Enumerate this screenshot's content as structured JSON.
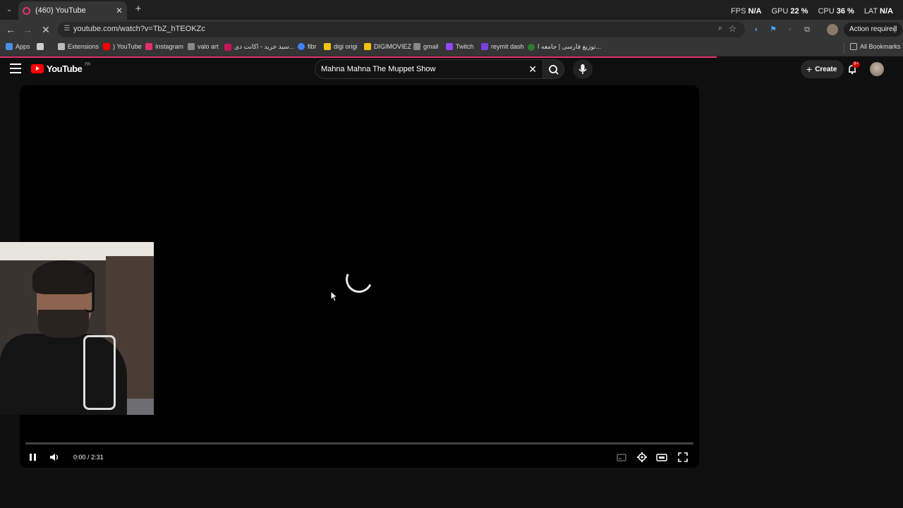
{
  "browser": {
    "tab_title": "(460) YouTube",
    "perf": {
      "fps_label": "FPS",
      "fps_value": "N/A",
      "gpu_label": "GPU",
      "gpu_value": "22 %",
      "cpu_label": "CPU",
      "cpu_value": "36 %",
      "lat_label": "LAT",
      "lat_value": "N/A"
    },
    "url": "youtube.com/watch?v=TbZ_hTEOKZc",
    "action_required": "Action required",
    "accent": "#e0326f"
  },
  "bookmarks": {
    "items": [
      {
        "label": "Apps",
        "color": "#4a90e2"
      },
      {
        "label": "Extensions",
        "color": "#bbbbbb"
      },
      {
        "label": ") YouTube",
        "color": "#ff0000"
      },
      {
        "label": "Instagram",
        "color": "#e1306c"
      },
      {
        "label": "valo art",
        "color": "#888888"
      },
      {
        "label": "سید خرید - اکانت دی...",
        "color": "#c2185b"
      },
      {
        "label": "fibr",
        "color": "#3f83f8"
      },
      {
        "label": "digi origi",
        "color": "#f4c20d"
      },
      {
        "label": "DIGIMOVIEZ",
        "color": "#f4c20d"
      },
      {
        "label": "gmail",
        "color": "#888888"
      },
      {
        "label": "Twitch",
        "color": "#9146ff"
      },
      {
        "label": "reymit dash",
        "color": "#7b3fe4"
      },
      {
        "label": "توزیع فارسی | جامعه ا...",
        "color": "#2e7d32"
      }
    ],
    "all_bookmarks": "All Bookmarks"
  },
  "youtube": {
    "logo_text": "YouTube",
    "country_code": "FR",
    "search_query": "Mahna Mahna The Muppet Show",
    "create_label": "Create",
    "notification_badge": "9+",
    "brand_color": "#ff0000"
  },
  "player": {
    "time_current": "0:00",
    "time_separator": "/",
    "time_total": "2:31",
    "state": "loading"
  }
}
